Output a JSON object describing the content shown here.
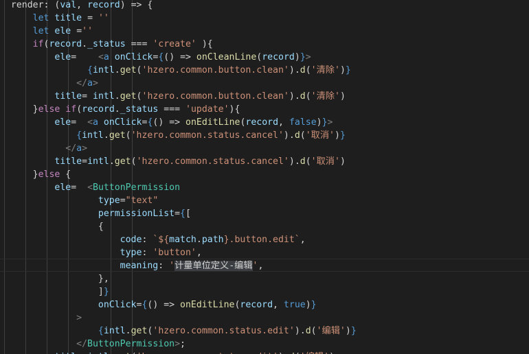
{
  "editor": {
    "lines": [
      [
        [
          "pl",
          "  render: ("
        ],
        [
          "vr",
          "val"
        ],
        [
          "pl",
          ", "
        ],
        [
          "vr",
          "record"
        ],
        [
          "pl",
          ") => {"
        ]
      ],
      [
        [
          "pl",
          "      "
        ],
        [
          "kb",
          "let"
        ],
        [
          "pl",
          " "
        ],
        [
          "vr",
          "title"
        ],
        [
          "pl",
          " = "
        ],
        [
          "st",
          "''"
        ]
      ],
      [
        [
          "pl",
          "      "
        ],
        [
          "kb",
          "let"
        ],
        [
          "pl",
          " "
        ],
        [
          "vr",
          "ele"
        ],
        [
          "pl",
          " ="
        ],
        [
          "st",
          "''"
        ]
      ],
      [
        [
          "pl",
          "      "
        ],
        [
          "kw",
          "if"
        ],
        [
          "pl",
          "("
        ],
        [
          "vr",
          "record"
        ],
        [
          "pl",
          "."
        ],
        [
          "vr",
          "_status"
        ],
        [
          "pl",
          " === "
        ],
        [
          "st",
          "'create'"
        ],
        [
          "pl",
          " ){"
        ]
      ],
      [
        [
          "pl",
          "          "
        ],
        [
          "vr",
          "ele"
        ],
        [
          "pl",
          "=    "
        ],
        [
          "pn",
          "<"
        ],
        [
          "kb",
          "a"
        ],
        [
          "pl",
          " "
        ],
        [
          "vr",
          "onClick"
        ],
        [
          "pl",
          "="
        ],
        [
          "kb",
          "{"
        ],
        [
          "pl",
          "() => "
        ],
        [
          "fn",
          "onCleanLine"
        ],
        [
          "pl",
          "("
        ],
        [
          "vr",
          "record"
        ],
        [
          "pl",
          ")"
        ],
        [
          "kb",
          "}"
        ],
        [
          "pn",
          ">"
        ]
      ],
      [
        [
          "pl",
          "                "
        ],
        [
          "kb",
          "{"
        ],
        [
          "vr",
          "intl"
        ],
        [
          "pl",
          "."
        ],
        [
          "fn",
          "get"
        ],
        [
          "pl",
          "("
        ],
        [
          "st",
          "'hzero.common.button.clean'"
        ],
        [
          "pl",
          ")."
        ],
        [
          "fn",
          "d"
        ],
        [
          "pl",
          "("
        ],
        [
          "st",
          "'清除'"
        ],
        [
          "pl",
          ")"
        ],
        [
          "kb",
          "}"
        ]
      ],
      [
        [
          "pl",
          "              "
        ],
        [
          "pn",
          "</"
        ],
        [
          "kb",
          "a"
        ],
        [
          "pn",
          ">"
        ]
      ],
      [
        [
          "pl",
          "          "
        ],
        [
          "vr",
          "title"
        ],
        [
          "pl",
          "= "
        ],
        [
          "vr",
          "intl"
        ],
        [
          "pl",
          "."
        ],
        [
          "fn",
          "get"
        ],
        [
          "pl",
          "("
        ],
        [
          "st",
          "'hzero.common.button.clean'"
        ],
        [
          "pl",
          ")."
        ],
        [
          "fn",
          "d"
        ],
        [
          "pl",
          "("
        ],
        [
          "st",
          "'清除'"
        ],
        [
          "pl",
          ")"
        ]
      ],
      [
        [
          "pl",
          "      }"
        ],
        [
          "kw",
          "else"
        ],
        [
          "pl",
          " "
        ],
        [
          "kw",
          "if"
        ],
        [
          "pl",
          "("
        ],
        [
          "vr",
          "record"
        ],
        [
          "pl",
          "."
        ],
        [
          "vr",
          "_status"
        ],
        [
          "pl",
          " === "
        ],
        [
          "st",
          "'update'"
        ],
        [
          "pl",
          "){"
        ]
      ],
      [
        [
          "pl",
          "          "
        ],
        [
          "vr",
          "ele"
        ],
        [
          "pl",
          "=  "
        ],
        [
          "pn",
          "<"
        ],
        [
          "kb",
          "a"
        ],
        [
          "pl",
          " "
        ],
        [
          "vr",
          "onClick"
        ],
        [
          "pl",
          "="
        ],
        [
          "kb",
          "{"
        ],
        [
          "pl",
          "() => "
        ],
        [
          "fn",
          "onEditLine"
        ],
        [
          "pl",
          "("
        ],
        [
          "vr",
          "record"
        ],
        [
          "pl",
          ", "
        ],
        [
          "kb",
          "false"
        ],
        [
          "pl",
          ")"
        ],
        [
          "kb",
          "}"
        ],
        [
          "pn",
          ">"
        ]
      ],
      [
        [
          "pl",
          "              "
        ],
        [
          "kb",
          "{"
        ],
        [
          "vr",
          "intl"
        ],
        [
          "pl",
          "."
        ],
        [
          "fn",
          "get"
        ],
        [
          "pl",
          "("
        ],
        [
          "st",
          "'hzero.common.status.cancel'"
        ],
        [
          "pl",
          ")."
        ],
        [
          "fn",
          "d"
        ],
        [
          "pl",
          "("
        ],
        [
          "st",
          "'取消'"
        ],
        [
          "pl",
          ")"
        ],
        [
          "kb",
          "}"
        ]
      ],
      [
        [
          "pl",
          "            "
        ],
        [
          "pn",
          "</"
        ],
        [
          "kb",
          "a"
        ],
        [
          "pn",
          ">"
        ]
      ],
      [
        [
          "pl",
          "          "
        ],
        [
          "vr",
          "title"
        ],
        [
          "pl",
          "="
        ],
        [
          "vr",
          "intl"
        ],
        [
          "pl",
          "."
        ],
        [
          "fn",
          "get"
        ],
        [
          "pl",
          "("
        ],
        [
          "st",
          "'hzero.common.status.cancel'"
        ],
        [
          "pl",
          ")."
        ],
        [
          "fn",
          "d"
        ],
        [
          "pl",
          "("
        ],
        [
          "st",
          "'取消'"
        ],
        [
          "pl",
          ")"
        ]
      ],
      [
        [
          "pl",
          "      }"
        ],
        [
          "kw",
          "else"
        ],
        [
          "pl",
          " {"
        ]
      ],
      [
        [
          "pl",
          "          "
        ],
        [
          "vr",
          "ele"
        ],
        [
          "pl",
          "=  "
        ],
        [
          "pn",
          "<"
        ],
        [
          "tg",
          "ButtonPermission"
        ]
      ],
      [
        [
          "pl",
          "                  "
        ],
        [
          "vr",
          "type"
        ],
        [
          "pl",
          "="
        ],
        [
          "st",
          "\"text\""
        ]
      ],
      [
        [
          "pl",
          "                  "
        ],
        [
          "vr",
          "permissionList"
        ],
        [
          "pl",
          "="
        ],
        [
          "kb",
          "{"
        ],
        [
          "pl",
          "["
        ]
      ],
      [
        [
          "pl",
          "                  {"
        ]
      ],
      [
        [
          "pl",
          "                      "
        ],
        [
          "vr",
          "code"
        ],
        [
          "pl",
          ": "
        ],
        [
          "st",
          "`${"
        ],
        [
          "vr",
          "match"
        ],
        [
          "pl",
          "."
        ],
        [
          "vr",
          "path"
        ],
        [
          "st",
          "}.button.edit`"
        ],
        [
          "pl",
          ","
        ]
      ],
      [
        [
          "pl",
          "                      "
        ],
        [
          "vr",
          "type"
        ],
        [
          "pl",
          ": "
        ],
        [
          "st",
          "'button'"
        ],
        [
          "pl",
          ","
        ]
      ],
      [
        [
          "pl",
          "                      "
        ],
        [
          "vr",
          "meaning"
        ],
        [
          "pl",
          ": "
        ],
        [
          "st",
          "'"
        ],
        [
          "sel",
          "计量单位定义-编辑"
        ],
        [
          "st",
          "'"
        ],
        [
          "pl",
          ","
        ]
      ],
      [
        [
          "pl",
          "                  },"
        ]
      ],
      [
        [
          "pl",
          "                  ]"
        ],
        [
          "kb",
          "}"
        ]
      ],
      [
        [
          "pl",
          "                  "
        ],
        [
          "vr",
          "onClick"
        ],
        [
          "pl",
          "="
        ],
        [
          "kb",
          "{"
        ],
        [
          "pl",
          "() => "
        ],
        [
          "fn",
          "onEditLine"
        ],
        [
          "pl",
          "("
        ],
        [
          "vr",
          "record"
        ],
        [
          "pl",
          ", "
        ],
        [
          "kb",
          "true"
        ],
        [
          "pl",
          ")"
        ],
        [
          "kb",
          "}"
        ]
      ],
      [
        [
          "pl",
          "              "
        ],
        [
          "pn",
          ">"
        ]
      ],
      [
        [
          "pl",
          "                  "
        ],
        [
          "kb",
          "{"
        ],
        [
          "vr",
          "intl"
        ],
        [
          "pl",
          "."
        ],
        [
          "fn",
          "get"
        ],
        [
          "pl",
          "("
        ],
        [
          "st",
          "'hzero.common.status.edit'"
        ],
        [
          "pl",
          ")."
        ],
        [
          "fn",
          "d"
        ],
        [
          "pl",
          "("
        ],
        [
          "st",
          "'编辑'"
        ],
        [
          "pl",
          ")"
        ],
        [
          "kb",
          "}"
        ]
      ],
      [
        [
          "pl",
          "              "
        ],
        [
          "pn",
          "</"
        ],
        [
          "tg",
          "ButtonPermission"
        ],
        [
          "pn",
          ">"
        ],
        [
          "pl",
          ";"
        ]
      ],
      [
        [
          "pl",
          "          "
        ],
        [
          "vr",
          "title"
        ],
        [
          "pl",
          "="
        ],
        [
          "vr",
          "intl"
        ],
        [
          "pl",
          "."
        ],
        [
          "fn",
          "get"
        ],
        [
          "pl",
          "("
        ],
        [
          "st",
          "'hzero.common.status.edit'"
        ],
        [
          "pl",
          ")."
        ],
        [
          "fn",
          "d"
        ],
        [
          "pl",
          "("
        ],
        [
          "st",
          "'编辑'"
        ],
        [
          "pl",
          ")"
        ]
      ]
    ]
  },
  "theme": {
    "background": "#1e1e1e",
    "keyword": "#c586c0",
    "builtin": "#569cd6",
    "string": "#ce9178",
    "function": "#dcdcaa",
    "variable": "#9cdcfe",
    "component": "#4ec9b0",
    "punctuation": "#808080",
    "text": "#d4d4d4"
  }
}
